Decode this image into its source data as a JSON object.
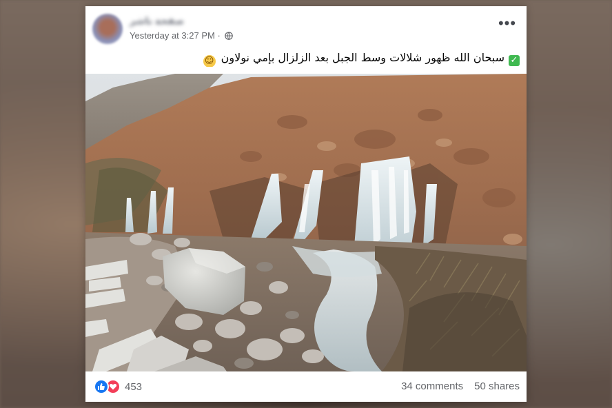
{
  "post": {
    "author_name": "صفحة ناشر",
    "timestamp": "Yesterday at 3:27 PM",
    "separator": "·",
    "privacy_icon": "globe-icon",
    "more_icon": "more-options-icon",
    "more_glyph": "•••",
    "text": "سبحان الله ظهور شلالات وسط الجبل بعد الزلزال بإمي نولاون",
    "text_prefix_emoji": "check-mark-emoji",
    "text_suffix_emoji": "smiling-face-emoji",
    "image": {
      "description": "mountain slope with waterfalls",
      "icon": "photo"
    }
  },
  "footer": {
    "reaction_icons": [
      "like-icon",
      "love-icon"
    ],
    "reaction_count": "453",
    "comments": "34 comments",
    "shares": "50 shares"
  },
  "colors": {
    "like": "#1877f2",
    "love": "#f33e58",
    "secondary_text": "#65676b",
    "primary_text": "#050505"
  }
}
